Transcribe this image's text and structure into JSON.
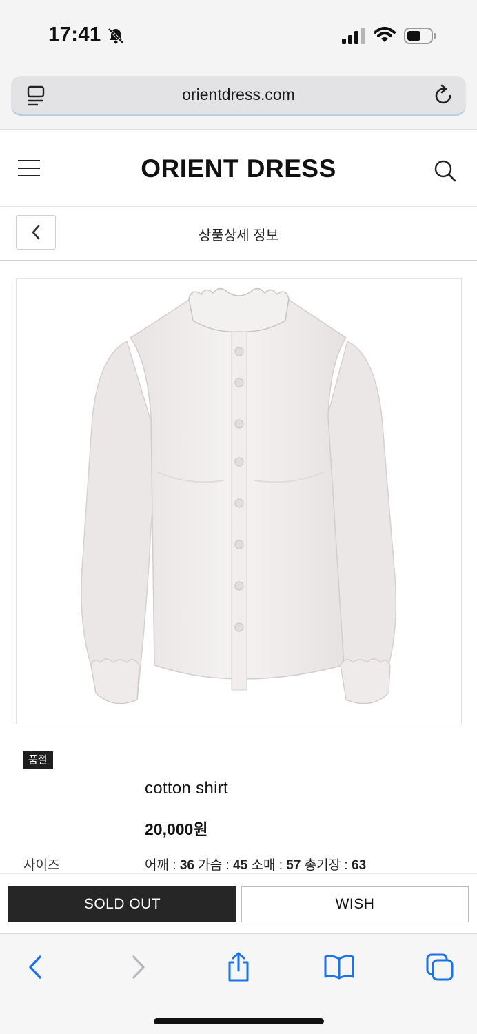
{
  "status": {
    "time": "17:41"
  },
  "browser": {
    "url": "orientdress.com"
  },
  "site": {
    "logo": "ORIENT DRESS"
  },
  "subheader": {
    "title": "상품상세 정보"
  },
  "product": {
    "badge": "품절",
    "name": "cotton shirt",
    "price": "20,000원",
    "size_label": "사이즈",
    "size_specs": [
      {
        "label": "어깨",
        "value": "36"
      },
      {
        "label": "가슴",
        "value": "45"
      },
      {
        "label": "소매",
        "value": "57"
      },
      {
        "label": "총기장",
        "value": "63"
      }
    ]
  },
  "actions": {
    "soldout_label": "SOLD OUT",
    "wish_label": "WISH"
  },
  "colors": {
    "accent": "#1a73e8",
    "dark_button": "#262626"
  }
}
